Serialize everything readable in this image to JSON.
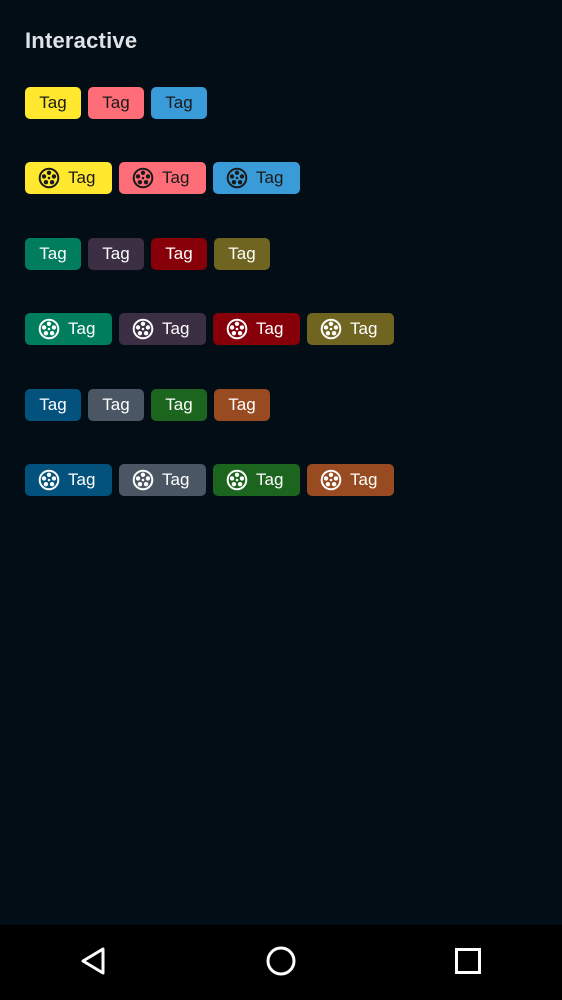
{
  "page": {
    "title": "Interactive"
  },
  "rows": [
    {
      "with_icon": false,
      "tags": [
        {
          "label": "Tag",
          "bg": "#ffe82d",
          "fg": "#1a1a1a"
        },
        {
          "label": "Tag",
          "bg": "#ff6e78",
          "fg": "#1a1a1a"
        },
        {
          "label": "Tag",
          "bg": "#3a9bd9",
          "fg": "#1a1a1a"
        }
      ]
    },
    {
      "with_icon": true,
      "tags": [
        {
          "label": "Tag",
          "bg": "#ffe82d",
          "fg": "#1a1a1a"
        },
        {
          "label": "Tag",
          "bg": "#ff6e78",
          "fg": "#1a1a1a"
        },
        {
          "label": "Tag",
          "bg": "#3a9bd9",
          "fg": "#1a1a1a"
        }
      ]
    },
    {
      "with_icon": false,
      "tags": [
        {
          "label": "Tag",
          "bg": "#007d5c",
          "fg": "#ffffff"
        },
        {
          "label": "Tag",
          "bg": "#3c2f44",
          "fg": "#ffffff"
        },
        {
          "label": "Tag",
          "bg": "#870009",
          "fg": "#ffffff"
        },
        {
          "label": "Tag",
          "bg": "#6f6521",
          "fg": "#ffffff"
        }
      ]
    },
    {
      "with_icon": true,
      "tags": [
        {
          "label": "Tag",
          "bg": "#007d5c",
          "fg": "#ffffff"
        },
        {
          "label": "Tag",
          "bg": "#3c2f44",
          "fg": "#ffffff"
        },
        {
          "label": "Tag",
          "bg": "#870009",
          "fg": "#ffffff"
        },
        {
          "label": "Tag",
          "bg": "#6f6521",
          "fg": "#ffffff"
        }
      ]
    },
    {
      "with_icon": false,
      "tags": [
        {
          "label": "Tag",
          "bg": "#02527d",
          "fg": "#ffffff"
        },
        {
          "label": "Tag",
          "bg": "#4a5663",
          "fg": "#ffffff"
        },
        {
          "label": "Tag",
          "bg": "#1c651e",
          "fg": "#ffffff"
        },
        {
          "label": "Tag",
          "bg": "#984a20",
          "fg": "#ffffff"
        }
      ]
    },
    {
      "with_icon": true,
      "tags": [
        {
          "label": "Tag",
          "bg": "#02527d",
          "fg": "#ffffff"
        },
        {
          "label": "Tag",
          "bg": "#4a5663",
          "fg": "#ffffff"
        },
        {
          "label": "Tag",
          "bg": "#1c651e",
          "fg": "#ffffff"
        },
        {
          "label": "Tag",
          "bg": "#984a20",
          "fg": "#ffffff"
        }
      ]
    }
  ],
  "tag_icon": "film-reel-icon",
  "navbar": {
    "back_icon": "back-triangle-icon",
    "home_icon": "home-circle-icon",
    "recents_icon": "recents-square-icon"
  }
}
